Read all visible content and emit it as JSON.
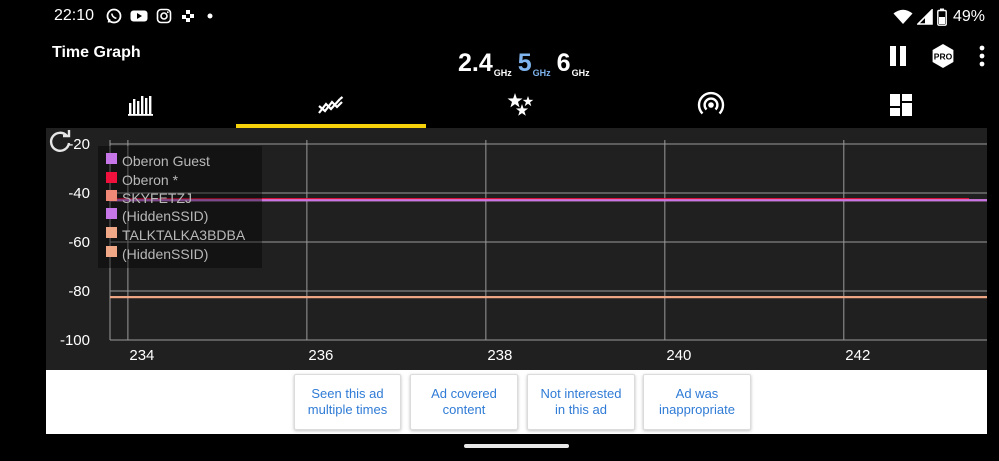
{
  "status_bar": {
    "time": "22:10",
    "battery": "49%",
    "icons": [
      "whatsapp-icon",
      "youtube-icon",
      "instagram-icon",
      "slack-icon",
      "dot-icon",
      "wifi-icon",
      "signal-icon",
      "battery-icon"
    ]
  },
  "header": {
    "title": "Time Graph",
    "bands": [
      {
        "label": "2.4",
        "unit": "GHz",
        "color": "#ffffff"
      },
      {
        "label": "5",
        "unit": "GHz",
        "color": "#7fb4ef"
      },
      {
        "label": "6",
        "unit": "GHz",
        "color": "#ffffff"
      }
    ],
    "pro_badge": "PRO",
    "icons": [
      "pause-icon",
      "pro-badge-icon",
      "more-vert-icon"
    ]
  },
  "tabs": [
    {
      "name": "channel-graph",
      "icon": "bar-chart-icon",
      "active": false
    },
    {
      "name": "time-graph",
      "icon": "time-graph-icon",
      "active": true
    },
    {
      "name": "channel-rating",
      "icon": "stars-icon",
      "active": false
    },
    {
      "name": "access-points",
      "icon": "signal-wave-icon",
      "active": false
    },
    {
      "name": "dashboard",
      "icon": "grid-icon",
      "active": false
    }
  ],
  "accent_color": "#f5d20a",
  "chart_data": {
    "type": "line",
    "y_ticks": [
      "-20",
      "-40",
      "-60",
      "-80",
      "-100"
    ],
    "x_ticks": [
      "234",
      "236",
      "238",
      "240",
      "242"
    ],
    "ylim": [
      -100,
      -20
    ],
    "xlim": [
      233.8,
      243.6
    ],
    "grid": true,
    "legend_position": "top-left",
    "series": [
      {
        "name": "Oberon  Guest",
        "color": "#c776e8",
        "x": [
          233.8,
          243.6
        ],
        "y": [
          -43,
          -43
        ]
      },
      {
        "name": "Oberon *",
        "color": "#f0123c",
        "x": [
          233.8,
          243.4
        ],
        "y": [
          -42.5,
          -42.5
        ]
      },
      {
        "name": "SKYFETZJ",
        "color": "#f08878",
        "x": [
          233.8,
          243.6
        ],
        "y": [
          -43,
          -43
        ]
      },
      {
        "name": "(HiddenSSID)",
        "color": "#c776e8",
        "x": [
          233.8,
          243.6
        ],
        "y": [
          -43,
          -43
        ]
      },
      {
        "name": "TALKTALKA3BDBA",
        "color": "#f0a886",
        "x": [
          233.8,
          243.6
        ],
        "y": [
          -82.5,
          -82.5
        ]
      },
      {
        "name": "(HiddenSSID)",
        "color": "#f0a886",
        "x": [
          233.8,
          243.6
        ],
        "y": [
          -82.5,
          -82.5
        ]
      }
    ]
  },
  "ad_feedback": {
    "buttons": [
      {
        "label": "Seen this ad\nmultiple times"
      },
      {
        "label": "Ad covered\ncontent"
      },
      {
        "label": "Not interested\nin this ad"
      },
      {
        "label": "Ad was\ninappropriate"
      }
    ]
  }
}
